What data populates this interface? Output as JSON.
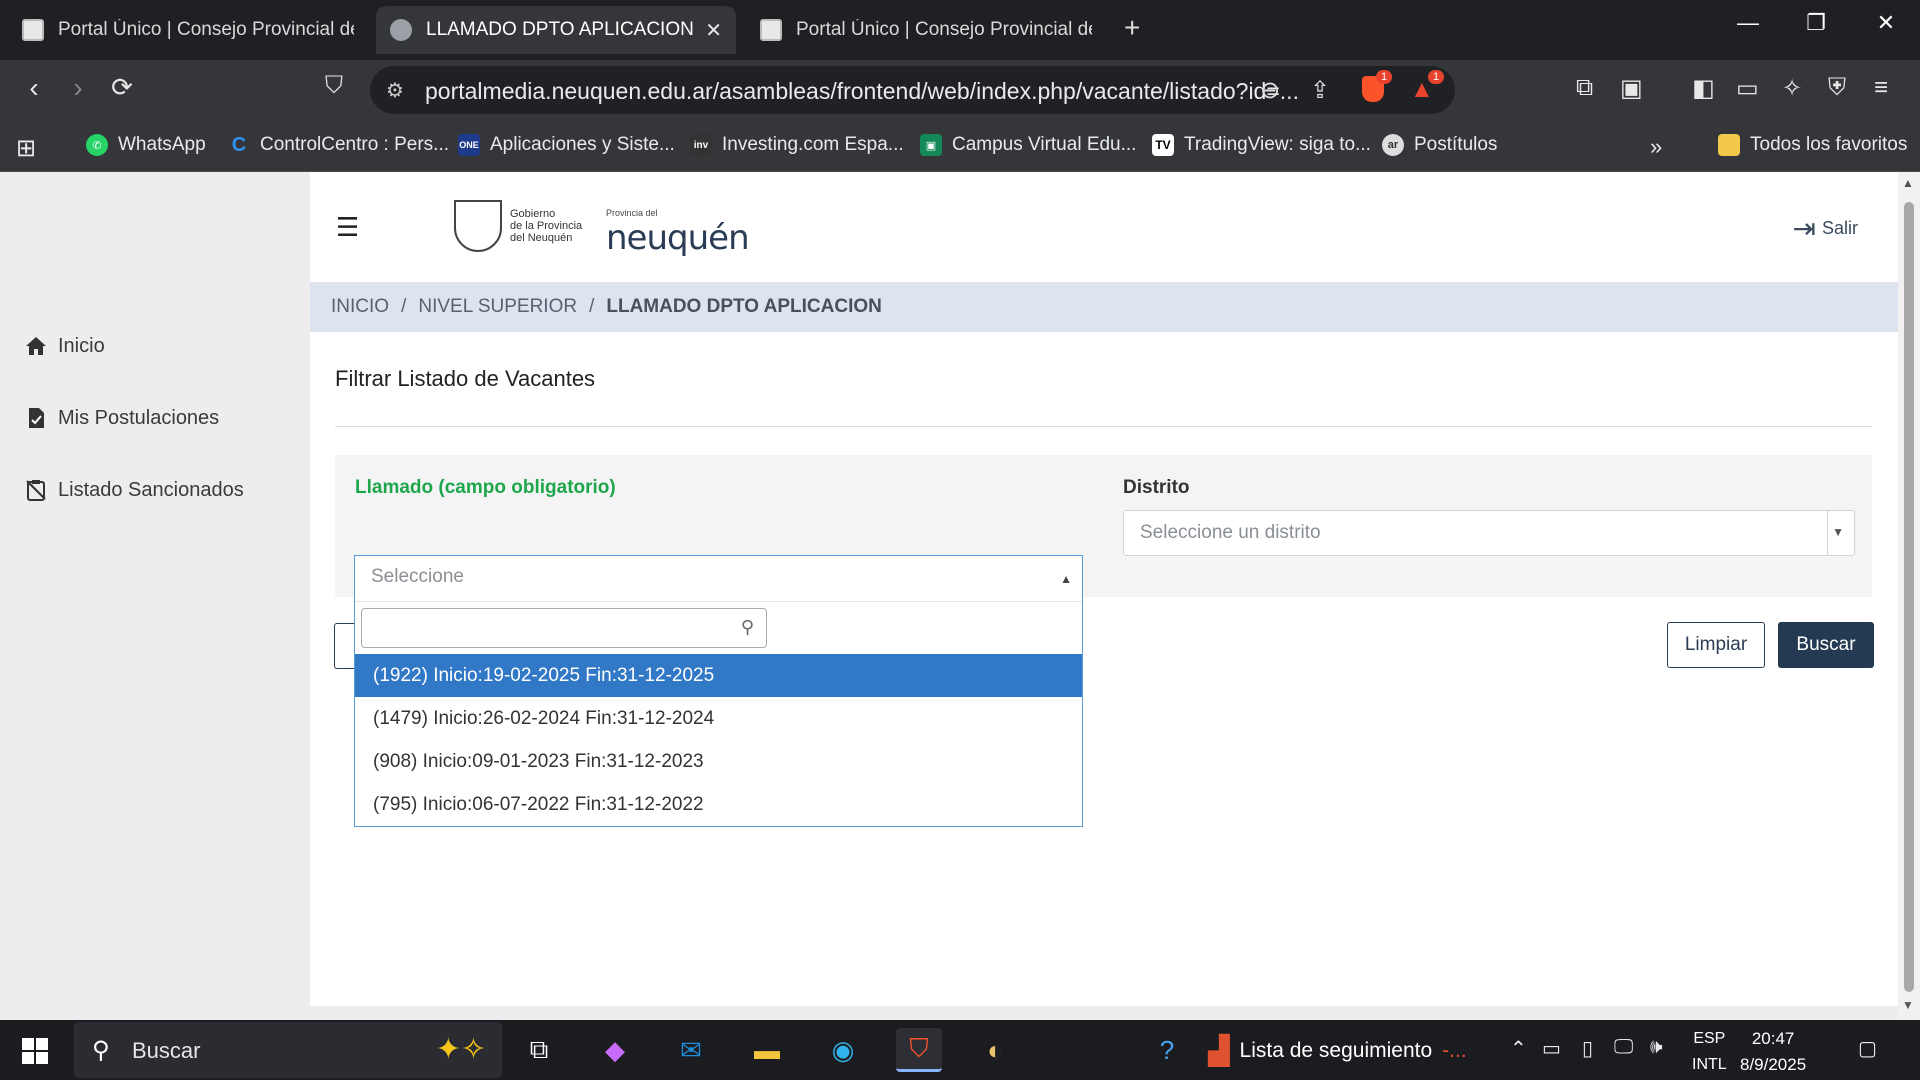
{
  "browser": {
    "tabs": [
      {
        "title": "Portal Único | Consejo Provincial de E",
        "active": false
      },
      {
        "title": "LLAMADO DPTO APLICACION",
        "active": true
      },
      {
        "title": "Portal Único | Consejo Provincial de E",
        "active": false
      }
    ],
    "url": "portalmedia.neuquen.edu.ar/asambleas/frontend/web/index.php/vacante/listado?id=...",
    "badges": {
      "brave_shields": "1",
      "rewards": "1"
    },
    "bookmarks": [
      {
        "label": "WhatsApp",
        "icon": "whatsapp-icon"
      },
      {
        "label": "ControlCentro : Pers...",
        "icon": "controlcentro-icon"
      },
      {
        "label": "Aplicaciones y Siste...",
        "icon": "one-icon"
      },
      {
        "label": "Investing.com Espa...",
        "icon": "investing-icon"
      },
      {
        "label": "Campus Virtual Edu...",
        "icon": "campus-icon"
      },
      {
        "label": "TradingView: siga to...",
        "icon": "tradingview-icon"
      },
      {
        "label": "Postítulos",
        "icon": "postitulos-icon"
      }
    ],
    "bookmarks_overflow": "»",
    "all_bookmarks": "Todos los favoritos"
  },
  "sidebar": {
    "items": [
      {
        "label": "Inicio",
        "icon": "home-icon"
      },
      {
        "label": "Mis Postulaciones",
        "icon": "document-check-icon"
      },
      {
        "label": "Listado Sancionados",
        "icon": "clipboard-x-icon"
      }
    ]
  },
  "header": {
    "logo_gob_lines": [
      "Gobierno",
      "de la Provincia",
      "del Neuquén"
    ],
    "logo_nqn_small": "Provincia del",
    "logo_nqn": "neuquén",
    "logout_label": "Salir"
  },
  "breadcrumb": {
    "items": [
      "INICIO",
      "NIVEL SUPERIOR"
    ],
    "separator": "/",
    "current": "LLAMADO DPTO APLICACION"
  },
  "page": {
    "title": "Filtrar Listado de Vacantes"
  },
  "filters": {
    "llamado": {
      "label": "Llamado (campo obligatorio)",
      "placeholder": "Seleccione",
      "search_value": "",
      "options": [
        "(1922) Inicio:19-02-2025 Fin:31-12-2025",
        "(1479) Inicio:26-02-2024 Fin:31-12-2024",
        "(908) Inicio:09-01-2023 Fin:31-12-2023",
        "(795) Inicio:06-07-2022 Fin:31-12-2022"
      ],
      "highlighted_index": 0
    },
    "distrito": {
      "label": "Distrito",
      "placeholder": "Seleccione un distrito"
    }
  },
  "actions": {
    "clear_label": "Limpiar",
    "search_label": "Buscar"
  },
  "colors": {
    "required_label": "#1ea64b",
    "primary_dark": "#243a52",
    "breadcrumb_bg": "#dde4ef",
    "option_highlight": "#3178c6"
  },
  "taskbar": {
    "search_label": "Buscar",
    "news_label": "Lista de seguimiento",
    "news_suffix": "-...",
    "lang_top": "ESP",
    "lang_bottom": "INTL",
    "time": "20:47",
    "date": "8/9/2025"
  }
}
